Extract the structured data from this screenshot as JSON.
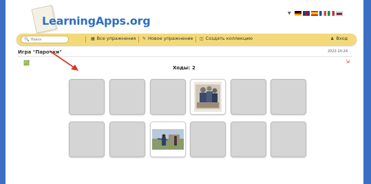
{
  "app": {
    "logo_text": "LearningApps.org"
  },
  "languages": [
    "de",
    "gb",
    "es",
    "fr",
    "it",
    "ru"
  ],
  "navbar": {
    "search_placeholder": "Поиск",
    "all_exercises": "Все упражнения",
    "new_exercise": "Новое упражнение",
    "create_collection": "Создать коллекцию",
    "login": "Вход"
  },
  "game": {
    "title": "Игра \"Парочки\"",
    "date": "2022-10-24",
    "moves_label": "Ходы:",
    "moves_value": "2",
    "cards": [
      {
        "state": "closed"
      },
      {
        "state": "closed"
      },
      {
        "state": "closed"
      },
      {
        "state": "open",
        "image": "old-photo-group-of-men"
      },
      {
        "state": "closed"
      },
      {
        "state": "closed"
      },
      {
        "state": "closed"
      },
      {
        "state": "closed"
      },
      {
        "state": "open",
        "image": "photo-people-in-field"
      },
      {
        "state": "closed"
      },
      {
        "state": "closed"
      },
      {
        "state": "closed"
      }
    ]
  },
  "colors": {
    "background": "#3c6fc4",
    "navbar": "#f3d97a",
    "card_back": "#d5d5d5",
    "logo": "#2d6fc0"
  }
}
